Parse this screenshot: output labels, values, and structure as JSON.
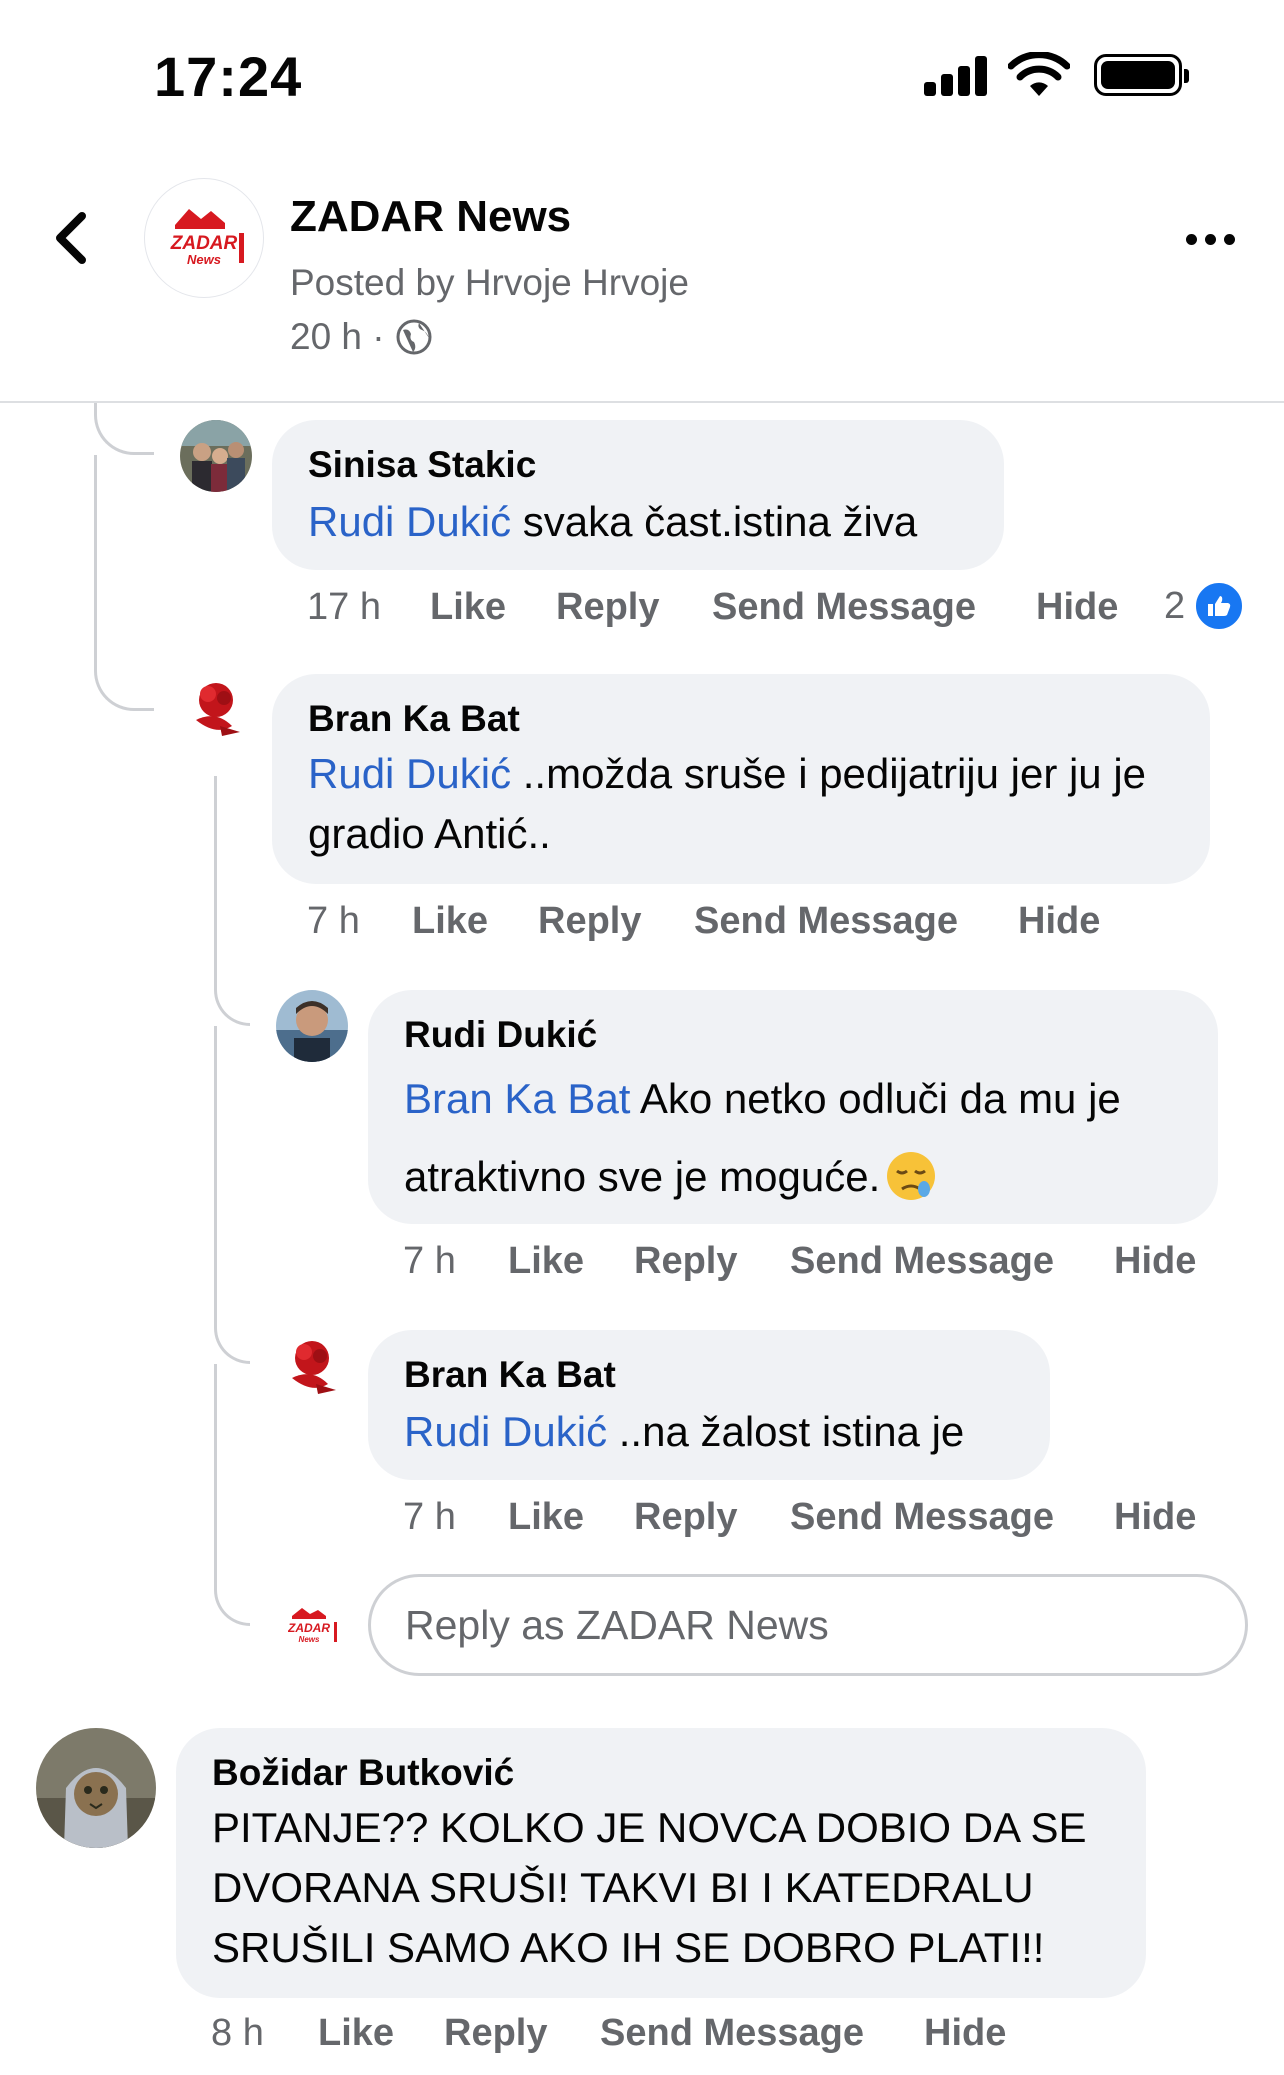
{
  "status_bar": {
    "time": "17:24"
  },
  "header": {
    "page_name": "ZADAR News",
    "posted_by": "Posted by Hrvoje Hrvoje",
    "post_age": "20 h ·",
    "logo_text_top": "ZADAR",
    "logo_text_bottom": "News"
  },
  "comments": [
    {
      "author": "Sinisa Stakic",
      "mention": "Rudi Dukić",
      "text": " svaka čast.istina živa",
      "time": "17 h",
      "like": "Like",
      "reply": "Reply",
      "send": "Send Message",
      "hide": "Hide",
      "reactions": "2"
    },
    {
      "author": "Bran Ka Bat",
      "mention": "Rudi Dukić",
      "text": " ..možda sruše i pedijatriju jer ju je gradio Antić..",
      "time": "7 h",
      "like": "Like",
      "reply": "Reply",
      "send": "Send Message",
      "hide": "Hide"
    },
    {
      "author": "Rudi Dukić",
      "mention": "Bran Ka Bat",
      "text": " Ako netko odluči da mu je atraktivno sve je moguće.",
      "time": "7 h",
      "like": "Like",
      "reply": "Reply",
      "send": "Send Message",
      "hide": "Hide"
    },
    {
      "author": "Bran Ka Bat",
      "mention": "Rudi Dukić",
      "text": " ..na žalost istina je",
      "time": "7 h",
      "like": "Like",
      "reply": "Reply",
      "send": "Send Message",
      "hide": "Hide"
    },
    {
      "author": "Božidar Butković",
      "text": "PITANJE?? KOLKO JE NOVCA DOBIO DA SE DVORANA SRUŠI! TAKVI BI I KATEDRALU SRUŠILI SAMO AKO IH SE DOBRO PLATI!!",
      "time": "8 h",
      "like": "Like",
      "reply": "Reply",
      "send": "Send Message",
      "hide": "Hide"
    }
  ],
  "reply_box": {
    "placeholder": "Reply as ZADAR News"
  },
  "colors": {
    "mention": "#2a63c8",
    "like_badge": "#1877f2",
    "bubble": "#f0f2f5"
  }
}
